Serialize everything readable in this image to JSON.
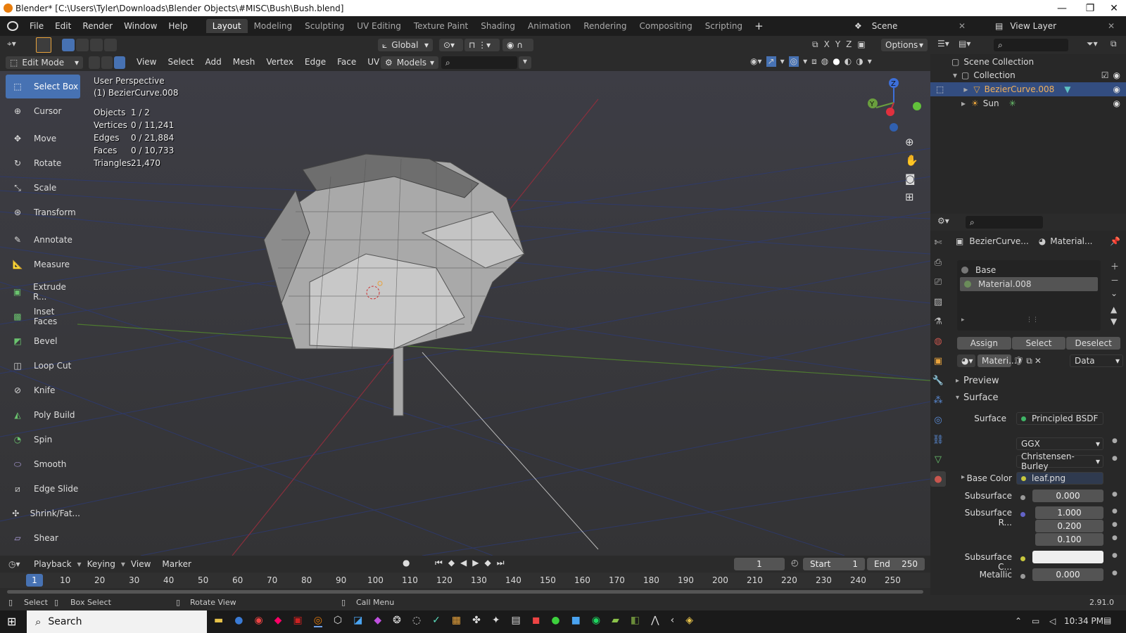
{
  "window": {
    "title": "Blender* [C:\\Users\\Tyler\\Downloads\\Blender Objects\\#MISC\\Bush\\Bush.blend]",
    "controls": [
      "—",
      "❐",
      "✕"
    ]
  },
  "menu": [
    "File",
    "Edit",
    "Render",
    "Window",
    "Help"
  ],
  "workspaces": [
    "Layout",
    "Modeling",
    "Sculpting",
    "UV Editing",
    "Texture Paint",
    "Shading",
    "Animation",
    "Rendering",
    "Compositing",
    "Scripting"
  ],
  "active_workspace": "Layout",
  "scene": "Scene",
  "view_layer": "View Layer",
  "header": {
    "transform_orientation": "Global",
    "options": "Options",
    "axes": [
      "X",
      "Y",
      "Z"
    ],
    "mode": "Edit Mode",
    "menus": [
      "View",
      "Select",
      "Add",
      "Mesh",
      "Vertex",
      "Edge",
      "Face",
      "UV"
    ],
    "collection_filter": "Models"
  },
  "viewport": {
    "perspective": "User Perspective",
    "object": "(1) BezierCurve.008",
    "stats": [
      {
        "label": "Objects",
        "value": "1 / 2"
      },
      {
        "label": "Vertices",
        "value": "0 / 11,241"
      },
      {
        "label": "Edges",
        "value": "0 / 21,884"
      },
      {
        "label": "Faces",
        "value": "0 / 10,733"
      },
      {
        "label": "Triangles",
        "value": "21,470"
      }
    ],
    "gizmo": {
      "z": "Z",
      "y": "Y"
    }
  },
  "tools": [
    {
      "label": "Select Box",
      "icon": "select-box-icon",
      "active": true
    },
    {
      "label": "Cursor",
      "icon": "cursor-icon"
    },
    {
      "label": "Move",
      "icon": "move-icon"
    },
    {
      "label": "Rotate",
      "icon": "rotate-icon"
    },
    {
      "label": "Scale",
      "icon": "scale-icon"
    },
    {
      "label": "Transform",
      "icon": "transform-icon"
    },
    {
      "label": "Annotate",
      "icon": "annotate-icon"
    },
    {
      "label": "Measure",
      "icon": "measure-icon"
    },
    {
      "label": "Extrude R...",
      "icon": "extrude-icon"
    },
    {
      "label": "Inset Faces",
      "icon": "inset-faces-icon"
    },
    {
      "label": "Bevel",
      "icon": "bevel-icon"
    },
    {
      "label": "Loop Cut",
      "icon": "loop-cut-icon"
    },
    {
      "label": "Knife",
      "icon": "knife-icon"
    },
    {
      "label": "Poly Build",
      "icon": "poly-build-icon"
    },
    {
      "label": "Spin",
      "icon": "spin-icon"
    },
    {
      "label": "Smooth",
      "icon": "smooth-icon"
    },
    {
      "label": "Edge Slide",
      "icon": "edge-slide-icon"
    },
    {
      "label": "Shrink/Fat...",
      "icon": "shrink-fatten-icon"
    },
    {
      "label": "Shear",
      "icon": "shear-icon"
    }
  ],
  "timeline": {
    "menus": [
      "Playback",
      "Keying",
      "View",
      "Marker"
    ],
    "current_frame": "1",
    "start_label": "Start",
    "start": "1",
    "end_label": "End",
    "end": "250",
    "ruler": [
      "1",
      "10",
      "20",
      "30",
      "40",
      "50",
      "60",
      "70",
      "80",
      "90",
      "100",
      "110",
      "120",
      "130",
      "140",
      "150",
      "160",
      "170",
      "180",
      "190",
      "200",
      "210",
      "220",
      "230",
      "240",
      "250"
    ]
  },
  "statusbar": {
    "items": [
      "Select",
      "Box Select",
      "Rotate View",
      "Call Menu"
    ],
    "version": "2.91.0"
  },
  "outliner": {
    "root": "Scene Collection",
    "collection": "Collection",
    "items": [
      {
        "name": "BezierCurve.008",
        "selected": true
      },
      {
        "name": "Sun",
        "selected": false
      }
    ]
  },
  "properties": {
    "object": "BezierCurve...",
    "material_tab": "Material...",
    "slots": [
      "Base",
      "Material.008"
    ],
    "slot_buttons": [
      "Assign",
      "Select",
      "Deselect"
    ],
    "material_name": "Materi...",
    "link": "Data",
    "panels": {
      "preview": "Preview",
      "surface": "Surface"
    },
    "surface_label": "Surface",
    "surface_value": "Principled BSDF",
    "distribution": "GGX",
    "subsurface_method": "Christensen-Burley",
    "rows": [
      {
        "label": "Base Color",
        "value": "leaf.png"
      },
      {
        "label": "Subsurface",
        "value": "0.000"
      },
      {
        "label": "Subsurface R...",
        "value": "1.000"
      },
      {
        "label": "",
        "value": "0.200"
      },
      {
        "label": "",
        "value": "0.100"
      },
      {
        "label": "Subsurface C...",
        "value": ""
      },
      {
        "label": "Metallic",
        "value": "0.000"
      }
    ]
  },
  "taskbar": {
    "search": "Search",
    "time": "10:34 PM"
  },
  "colors": {
    "accent": "#4772b3",
    "orange": "#e87d0d",
    "panel": "#282828",
    "header": "#2b2b2b"
  }
}
